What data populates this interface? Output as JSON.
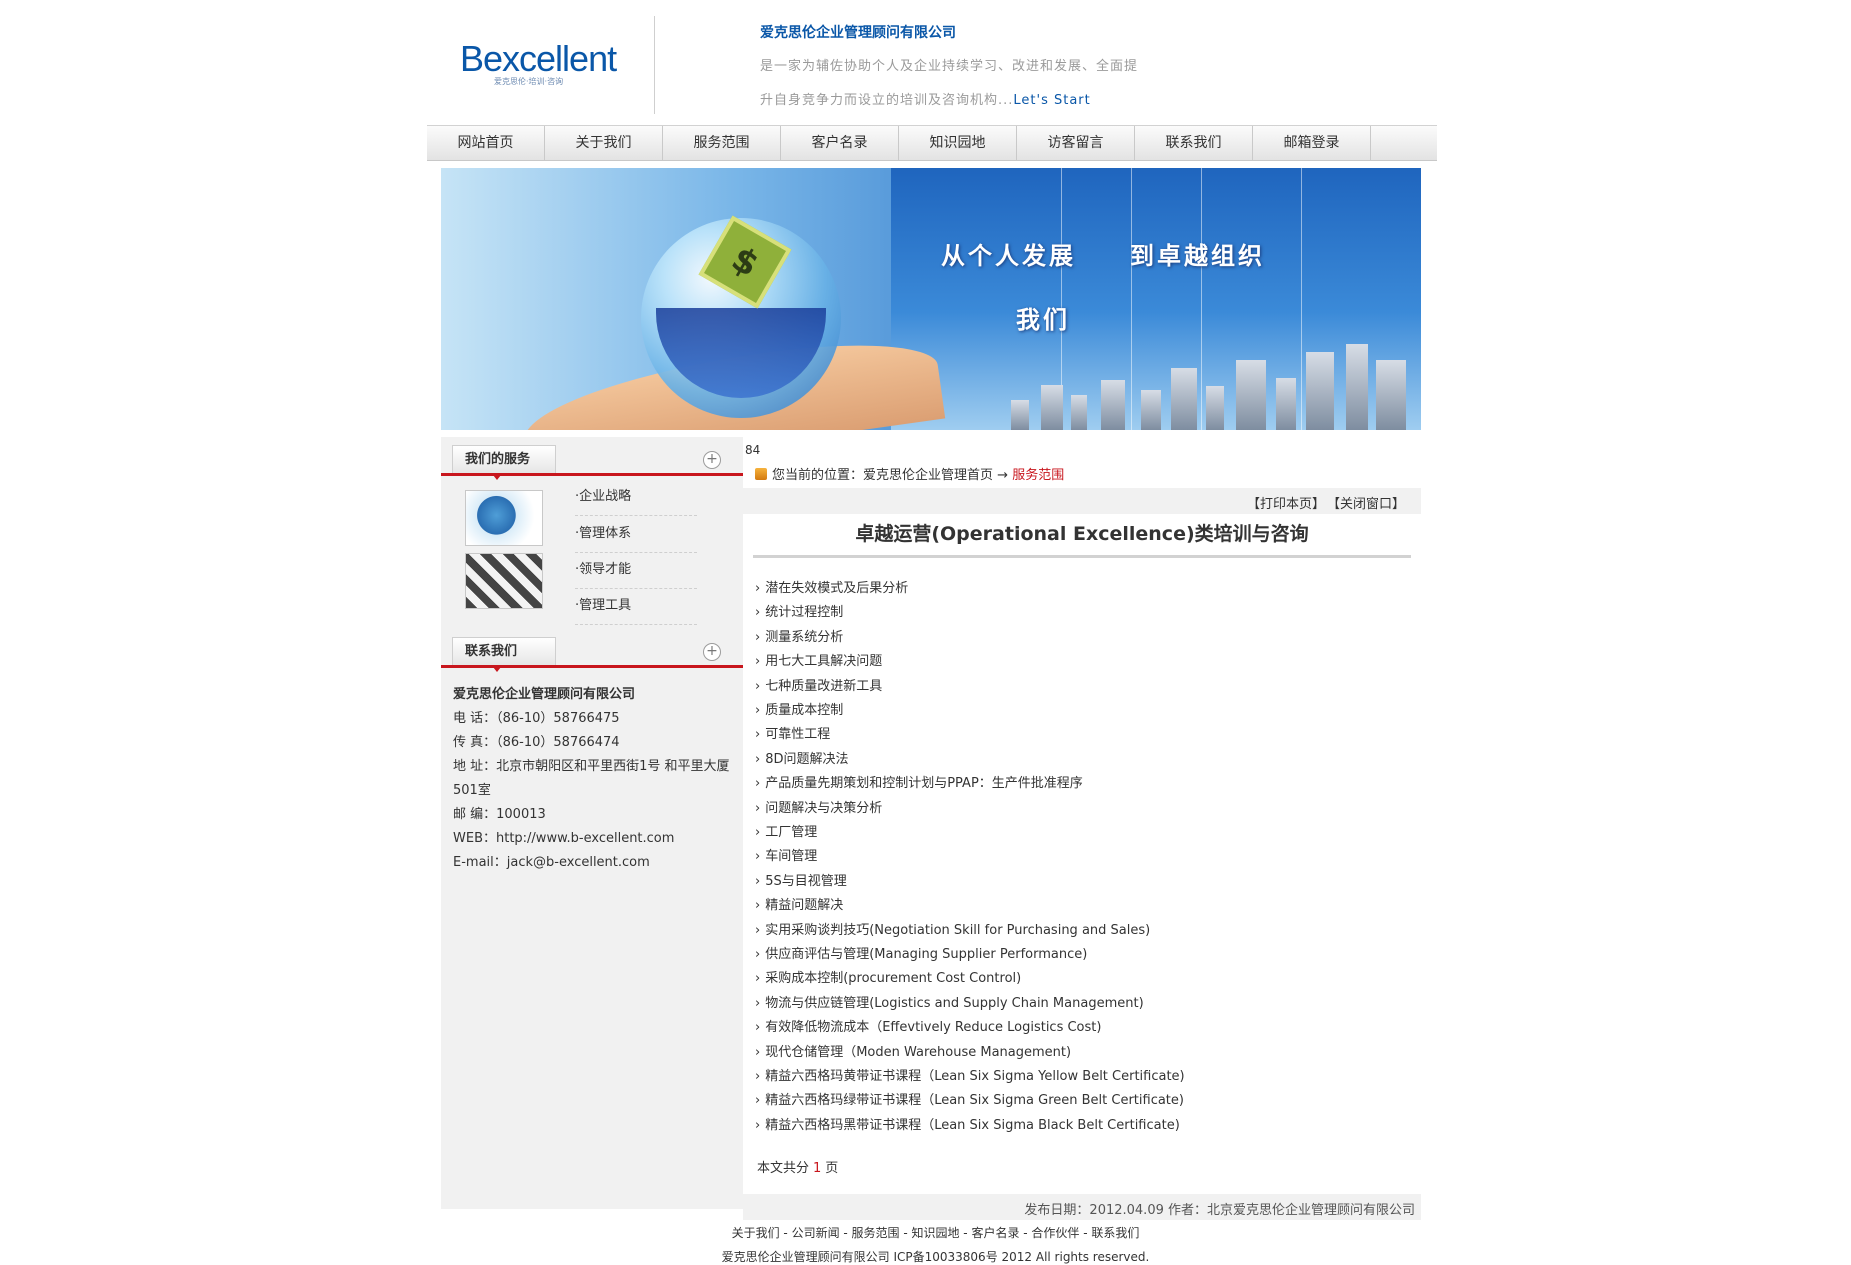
{
  "header": {
    "logo_text": "Bexcellent",
    "logo_sub": "爱克思伦·培训·咨询",
    "company_name": "爱克思伦企业管理顾问有限公司",
    "intro_line1": "是一家为辅佐协助个人及企业持续学习、改进和发展、全面提",
    "intro_line2": "升自身竞争力而设立的培训及咨询机构...",
    "intro_start": "Let's Start"
  },
  "nav": {
    "items": [
      "网站首页",
      "关于我们",
      "服务范围",
      "客户名录",
      "知识园地",
      "访客留言",
      "联系我们",
      "邮箱登录"
    ]
  },
  "banner": {
    "slogan_line1": "从个人发展　　到卓越组织",
    "slogan_line2": "我们",
    "chip_symbol": "$"
  },
  "sidebar": {
    "services_title": "我们的服务",
    "services": [
      "·企业战略",
      "·管理体系",
      "·领导才能",
      "·管理工具"
    ],
    "contact_title": "联系我们",
    "contact": {
      "company": "爱克思伦企业管理顾问有限公司",
      "phone": "电 话：（86-10）58766475",
      "fax": "传 真：（86-10）58766474",
      "address": "地 址：北京市朝阳区和平里西街1号 和平里大厦501室",
      "postcode": "邮 编：100013",
      "web": "WEB：http://www.b-excellent.com",
      "email": "E-mail：jack@b-excellent.com"
    }
  },
  "main": {
    "counter": "84",
    "breadcrumb_prefix": "您当前的位置：爱克思伦企业管理首页",
    "breadcrumb_arrow": "→",
    "breadcrumb_current": "服务范围",
    "print_label": "【打印本页】",
    "close_label": "【关闭窗口】",
    "title": "卓越运营(Operational Excellence)类培训与咨询",
    "items": [
      "潜在失效模式及后果分析",
      "统计过程控制",
      "测量系统分析",
      "用七大工具解决问题",
      "七种质量改进新工具",
      "质量成本控制",
      "可靠性工程",
      "8D问题解决法",
      "产品质量先期策划和控制计划与PPAP：生产件批准程序",
      "问题解决与决策分析",
      "工厂管理",
      "车间管理",
      "5S与目视管理",
      "精益问题解决",
      "实用采购谈判技巧(Negotiation Skill for Purchasing and Sales)",
      "供应商评估与管理(Managing Supplier Performance)",
      "采购成本控制(procurement Cost Control)",
      "物流与供应链管理(Logistics and Supply Chain Management)",
      "有效降低物流成本（Effevtively Reduce Logistics Cost)",
      "现代仓储管理（Moden Warehouse Management)",
      "精益六西格玛黄带证书课程（Lean Six Sigma Yellow Belt Certificate)",
      "精益六西格玛绿带证书课程（Lean Six Sigma Green Belt Certificate)",
      "精益六西格玛黑带证书课程（Lean Six Sigma Black Belt Certificate)"
    ],
    "pages_prefix": "本文共分",
    "pages_count": "1",
    "pages_suffix": "页",
    "publish_info": "发布日期：2012.04.09 作者：北京爱克思伦企业管理顾问有限公司"
  },
  "footer": {
    "links": "关于我们 - 公司新闻 - 服务范围 - 知识园地 - 客户名录 - 合作伙伴 - 联系我们",
    "copyright": "爱克思伦企业管理顾问有限公司 ICP备10033806号 2012 All rights reserved."
  },
  "colors": {
    "brand_blue": "#0a57a8",
    "accent_red": "#c8161d",
    "panel_gray": "#f1f1f1"
  }
}
